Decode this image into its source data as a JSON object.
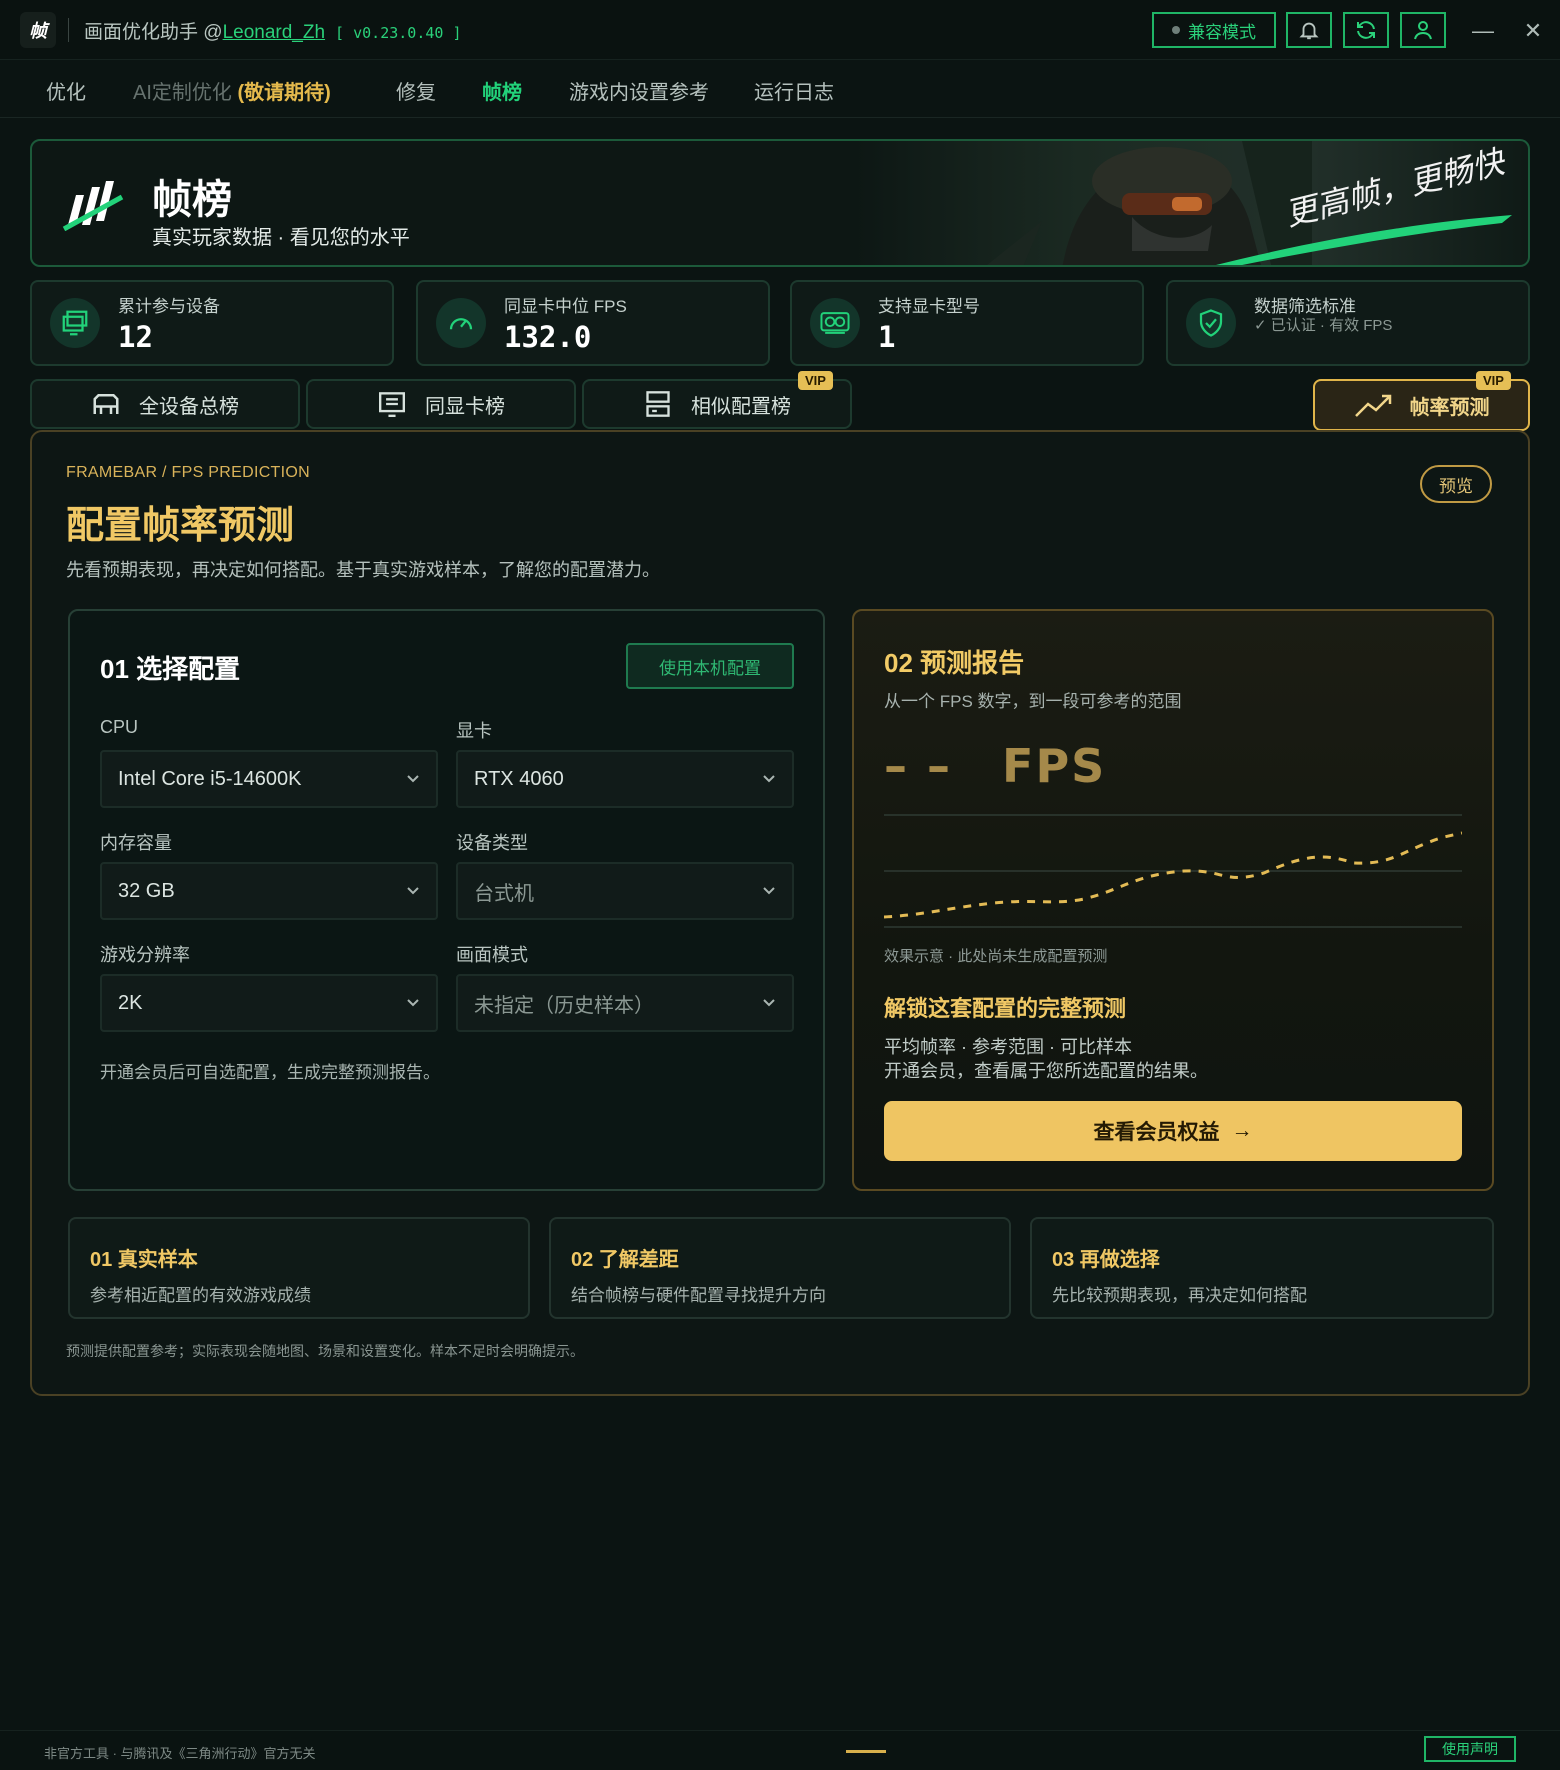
{
  "app": {
    "logo_char": "帧",
    "title_prefix": "画面优化助手 @",
    "username": "Leonard_Zh",
    "version": "[ v0.23.0.40 ]",
    "compat_label": "兼容模式"
  },
  "nav": {
    "tabs": [
      "优化",
      "AI定制优化",
      "修复",
      "帧榜",
      "游戏内设置参考",
      "运行日志"
    ],
    "ai_badge": "(敬请期待)",
    "active": "帧榜"
  },
  "banner": {
    "title": "帧榜",
    "subtitle": "真实玩家数据 · 看见您的水平",
    "slogan": "更高帧，更畅快"
  },
  "stats": [
    {
      "label": "累计参与设备",
      "value": "12"
    },
    {
      "label": "同显卡中位 FPS",
      "value": "132.0"
    },
    {
      "label": "支持显卡型号",
      "value": "1"
    },
    {
      "label": "数据筛选标准",
      "value": "✓ 已认证 · 有效 FPS"
    }
  ],
  "leaderboard_tabs": [
    "全设备总榜",
    "同显卡榜",
    "相似配置榜"
  ],
  "vip_label": "VIP",
  "fps_tab": "帧率预测",
  "panel": {
    "breadcrumb": "FRAMEBAR  /  FPS PREDICTION",
    "title": "配置帧率预测",
    "description": "先看预期表现，再决定如何搭配。基于真实游戏样本，了解您的配置潜力。",
    "preview_label": "预览"
  },
  "config": {
    "heading": "01  选择配置",
    "use_local_button": "使用本机配置",
    "fields": [
      {
        "label": "CPU",
        "value": "Intel Core i5-14600K"
      },
      {
        "label": "显卡",
        "value": "RTX 4060"
      },
      {
        "label": "内存容量",
        "value": "32 GB"
      },
      {
        "label": "设备类型",
        "value": "台式机"
      },
      {
        "label": "游戏分辨率",
        "value": "2K"
      },
      {
        "label": "画面模式",
        "value": "未指定（历史样本）"
      }
    ],
    "note": "开通会员后可自选配置，生成完整预测报告。"
  },
  "report": {
    "heading": "02  预测报告",
    "subtitle": "从一个 FPS 数字，到一段可参考的范围",
    "fps_placeholder": "– –",
    "fps_unit": "FPS",
    "chart_note": "效果示意 · 此处尚未生成配置预测",
    "unlock_title": "解锁这套配置的完整预测",
    "unlock_line1": "平均帧率 · 参考范围 · 可比样本",
    "unlock_line2": "开通会员，查看属于您所选配置的结果。",
    "member_button": "查看会员权益",
    "member_arrow": "→"
  },
  "cards": [
    {
      "title": "01  真实样本",
      "desc": "参考相近配置的有效游戏成绩"
    },
    {
      "title": "02  了解差距",
      "desc": "结合帧榜与硬件配置寻找提升方向"
    },
    {
      "title": "03  再做选择",
      "desc": "先比较预期表现，再决定如何搭配"
    }
  ],
  "disclaimer": "预测提供配置参考；实际表现会随地图、场景和设置变化。样本不足时会明确提示。",
  "footer": {
    "left": "非官方工具  ·  与腾讯及《三角洲行动》官方无关",
    "right_button": "使用声明"
  },
  "colors": {
    "accent_green": "#22d27a",
    "accent_gold": "#f0c865"
  }
}
